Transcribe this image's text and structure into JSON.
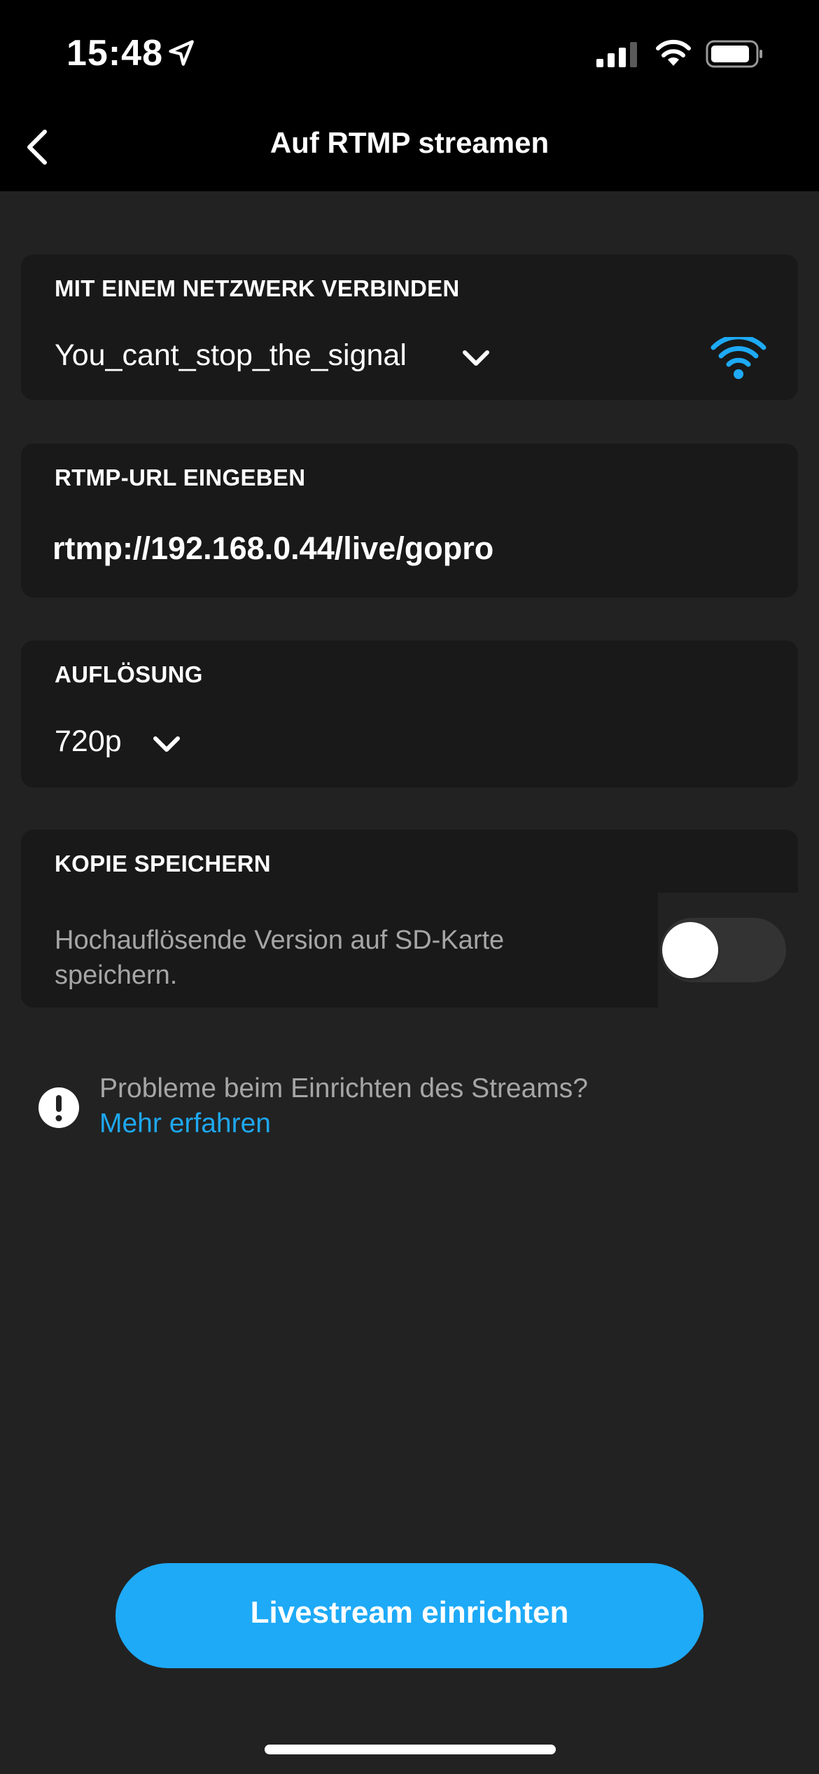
{
  "status_bar": {
    "time": "15:48",
    "icons": [
      "location-arrow-icon",
      "cellular-signal-icon",
      "wifi-icon",
      "battery-icon"
    ]
  },
  "nav": {
    "title": "Auf RTMP streamen",
    "back_icon": "chevron-left-icon"
  },
  "network_card": {
    "title": "MIT EINEM NETZWERK VERBINDEN",
    "selected_network": "You_cant_stop_the_signal",
    "dropdown_icon": "chevron-down-icon",
    "status_icon": "wifi-icon"
  },
  "rtmp_card": {
    "title": "RTMP-URL EINGEBEN",
    "url_value": "rtmp://192.168.0.44/live/gopro"
  },
  "resolution_card": {
    "title": "AUFLÖSUNG",
    "selected_resolution": "720p",
    "dropdown_icon": "chevron-down-icon"
  },
  "copy_card": {
    "title": "KOPIE SPEICHERN",
    "description": "Hochauflösende Version auf SD-Karte speichern.",
    "toggle_on": false
  },
  "help": {
    "text": "Probleme beim Einrichten des Streams?",
    "link": "Mehr erfahren",
    "icon": "exclamation-circle-icon"
  },
  "primary_button": {
    "label": "Livestream einrichten"
  },
  "colors": {
    "accent": "#1EAAF7",
    "link": "#1EA8F2",
    "background": "#222222",
    "card": "#191919",
    "header": "#000000",
    "secondary_text": "#A6A6A6"
  }
}
